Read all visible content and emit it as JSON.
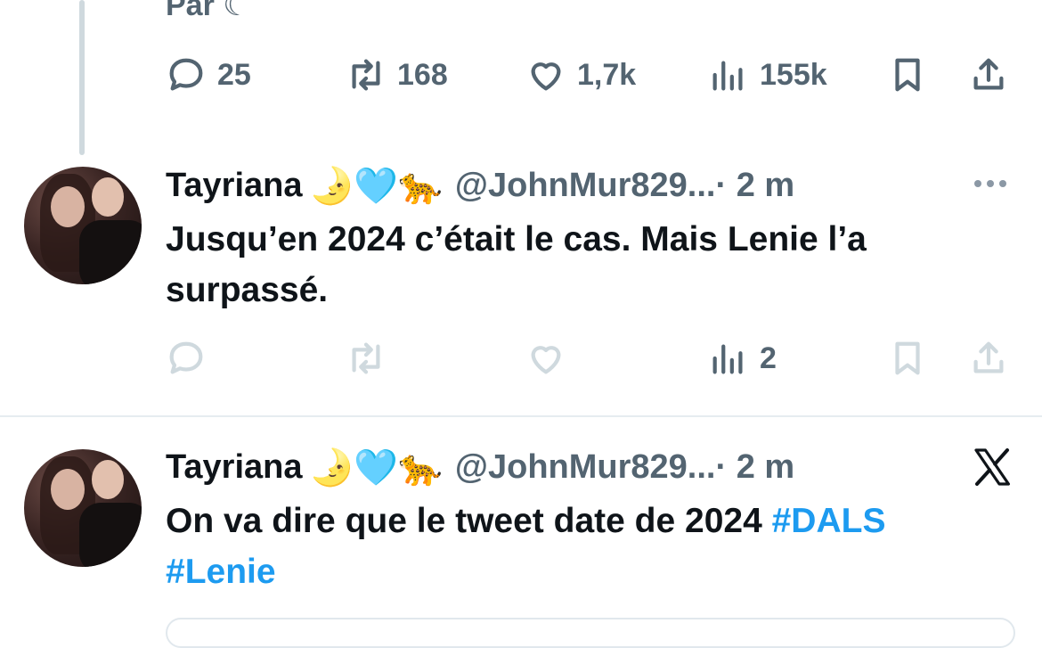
{
  "previous_tweet": {
    "text_fragment": "Par ☾",
    "actions": {
      "replies": "25",
      "retweets": "168",
      "likes": "1,7k",
      "views": "155k"
    }
  },
  "reply_tweet": {
    "author_name": "Tayriana",
    "author_emojis": [
      "🌛",
      "🩵",
      "🐆"
    ],
    "handle": "@JohnMur829...",
    "time": "· 2 m",
    "text": "Jusqu’en 2024 c’était le cas. Mais Lenie l’a surpassé.",
    "actions": {
      "replies": "",
      "retweets": "",
      "likes": "",
      "views": "2"
    },
    "menu_icon": "more-horizontal-icon"
  },
  "quote_tweet": {
    "author_name": "Tayriana",
    "author_emojis": [
      "🌛",
      "🩵",
      "🐆"
    ],
    "handle": "@JohnMur829...",
    "time": "· 2 m",
    "text_plain": "On va dire que le tweet date de 2024 ",
    "hashtags": [
      "#DALS",
      "#Lenie"
    ],
    "brand_icon": "x-logo-icon"
  },
  "colors": {
    "text_primary": "#0f1419",
    "text_secondary": "#536471",
    "link": "#1d9bf0",
    "divider": "#e6ecf0",
    "thread_line": "#cfd9de"
  }
}
